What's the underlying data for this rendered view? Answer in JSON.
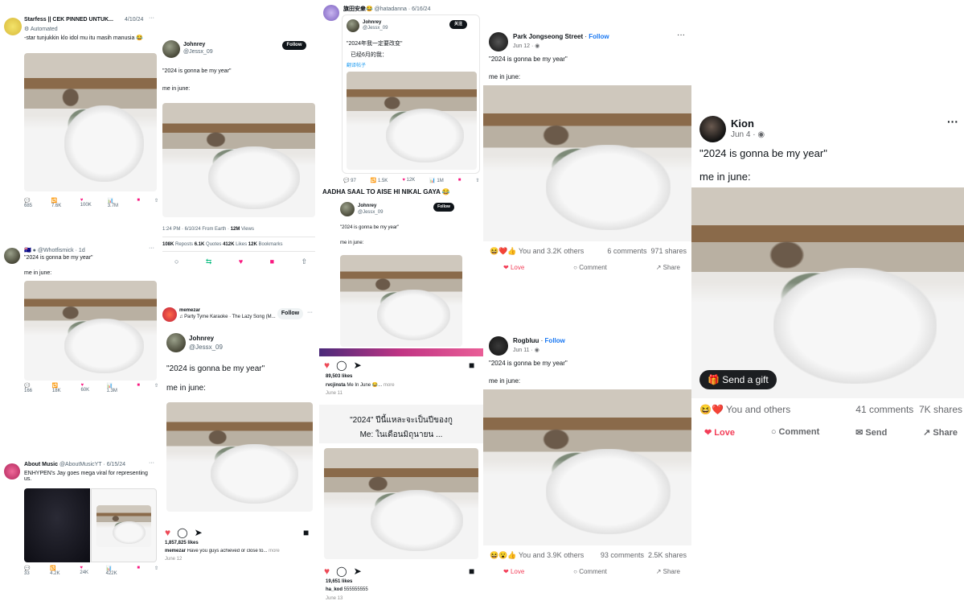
{
  "p1": {
    "name": "Starfess || CEK PINNED UNTUK...",
    "date": "4/10/24",
    "automated": "Automated",
    "text": "-star tunjukkin klo idol mu itu masih manusia 😂",
    "replies": "685",
    "rts": "7.6K",
    "likes": "100K",
    "views": "3.7M"
  },
  "p2": {
    "name": "Johnrey",
    "handle": "@Jessx_09",
    "follow": "Follow",
    "line1": "\"2024 is gonna be my year\"",
    "line2": "me in june:",
    "meta": "1:24 PM · 6/10/24 From Earth · ",
    "views": "12M",
    "views_label": " Views",
    "reposts": "108K",
    "reposts_label": " Reposts ",
    "quotes": "6.1K",
    "quotes_label": " Quotes ",
    "likes": "412K",
    "likes_label": " Likes ",
    "bookmarks": "12K",
    "bookmarks_label": " Bookmarks"
  },
  "p3": {
    "name": "旗田安衆😂",
    "handle": "@hatadanna",
    "date": "6/16/24",
    "inner_name": "Johnrey",
    "inner_handle": "@Jessx_09",
    "follow": "关注",
    "line1": "\"2024年我一定要改变\"",
    "line2": "已经6月的我：",
    "translate": "翻译帖子",
    "replies": "97",
    "rts": "1.5K",
    "likes": "12K",
    "views": "1M"
  },
  "p4": {
    "caption": "AADHA SAAL TO AISE HI NIKAL GAYA 😂",
    "name": "Johnrey",
    "handle": "@Jessx_09",
    "follow": "Follow",
    "line1": "\"2024 is gonna be my year\"",
    "line2": "me in june:"
  },
  "p5": {
    "name": "Park Jongseong Street",
    "follow": "Follow",
    "date": "Jun 12 ·",
    "line1": "\"2024 is gonna be my year\"",
    "line2": "me in june:",
    "reactions": "You and 3.2K others",
    "comments": "6 comments",
    "shares": "971 shares",
    "love": "Love",
    "comment": "Comment",
    "share": "Share"
  },
  "p6": {
    "name": "Kion",
    "date": "Jun 4 ·",
    "line1": "\"2024 is gonna be my year\"",
    "line2": "me in june:",
    "gift": "Send a gift",
    "reactions": "You and others",
    "comments": "41 comments",
    "shares": "7K shares",
    "love": "Love",
    "comment": "Comment",
    "send": "Send",
    "share": "Share"
  },
  "p7": {
    "handle": "@Whotfismick",
    "date": "1d",
    "line1": "\"2024 is gonna be my year\"",
    "line2": "me in june:",
    "replies": "166",
    "rts": "18K",
    "likes": "60K",
    "views": "1.3M"
  },
  "p8": {
    "name": "memezar",
    "sub": "Party Tyme Karaoke · The Lazy Song (M...",
    "follow": "Follow",
    "inner_name": "Johnrey",
    "inner_handle": "@Jessx_09",
    "line1": "\"2024 is gonna be my year\"",
    "line2": "me in june:",
    "likes": "1,857,825 likes",
    "caption_user": "memezar",
    "caption": " Have you guys achieved or close to...",
    "more": " more",
    "date": "June 12"
  },
  "p9": {
    "likes": "89,503 likes",
    "user": "rvcjinsta",
    "caption": " Me In June 😂...",
    "more": " more",
    "date": "June 11"
  },
  "p10": {
    "line1": "\"2024\" ปีนี้แหละจะเป็นปีของกู",
    "line2": "Me: ในเดือนมิถุนายน ...",
    "likes": "19,651 likes",
    "user": "ha_kod",
    "caption": " 555555555",
    "date": "June 13"
  },
  "p11": {
    "name": "Rogbluu",
    "follow": "Follow",
    "date": "Jun 11 ·",
    "line1": "\"2024 is gonna be my year\"",
    "line2": "me in june:",
    "reactions": "You and 3.9K others",
    "comments": "93 comments",
    "shares": "2.5K shares",
    "love": "Love",
    "comment": "Comment",
    "share": "Share"
  },
  "p12": {
    "name": "About Music",
    "handle": "@AboutMusicYT",
    "date": "6/15/24",
    "text": "ENHYPEN's Jay goes mega viral for representing us.",
    "replies": "33",
    "rts": "4.2K",
    "likes": "24K",
    "views": "422K"
  },
  "colors": {
    "x_blue": "#1d9bf0",
    "fb_blue": "#1877f2",
    "love_red": "#f33e58",
    "ig_red": "#ed4956"
  }
}
